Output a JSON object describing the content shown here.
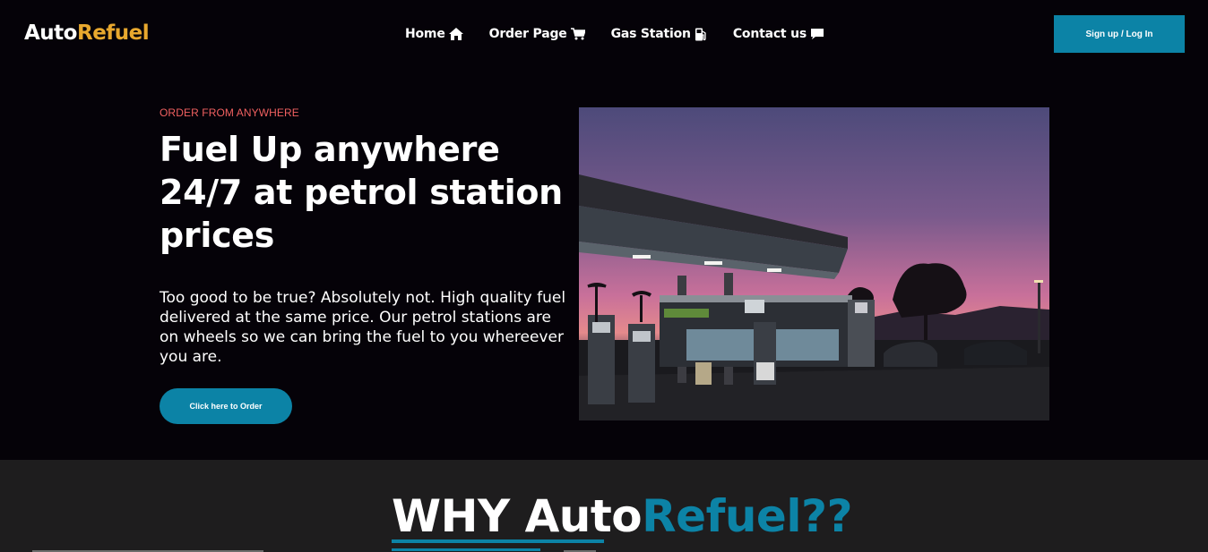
{
  "logo": {
    "part1": "Auto",
    "part2": "Refuel"
  },
  "nav": [
    {
      "label": "Home",
      "icon": "home-icon"
    },
    {
      "label": "Order Page",
      "icon": "cart-icon"
    },
    {
      "label": "Gas Station",
      "icon": "gas-pump-icon"
    },
    {
      "label": "Contact us",
      "icon": "comment-icon"
    }
  ],
  "signup_label": "Sign up / Log In",
  "hero": {
    "eyebrow": "ORDER FROM ANYWHERE",
    "headline": "Fuel Up anywhere 24/7 at petrol station prices",
    "description": "Too good to be true? Absolutely not. High quality fuel delivered at the same price. Our petrol stations are on wheels so we can bring the fuel to you whereever you are.",
    "cta": "Click here to Order"
  },
  "why": {
    "part1": "WHY Auto",
    "part2": "Refuel??"
  },
  "colors": {
    "accent": "#0c83a6",
    "logo_accent": "#e8a82e",
    "eyebrow": "#f06060",
    "background": "#050208",
    "section_bg": "#1e1d1e"
  }
}
